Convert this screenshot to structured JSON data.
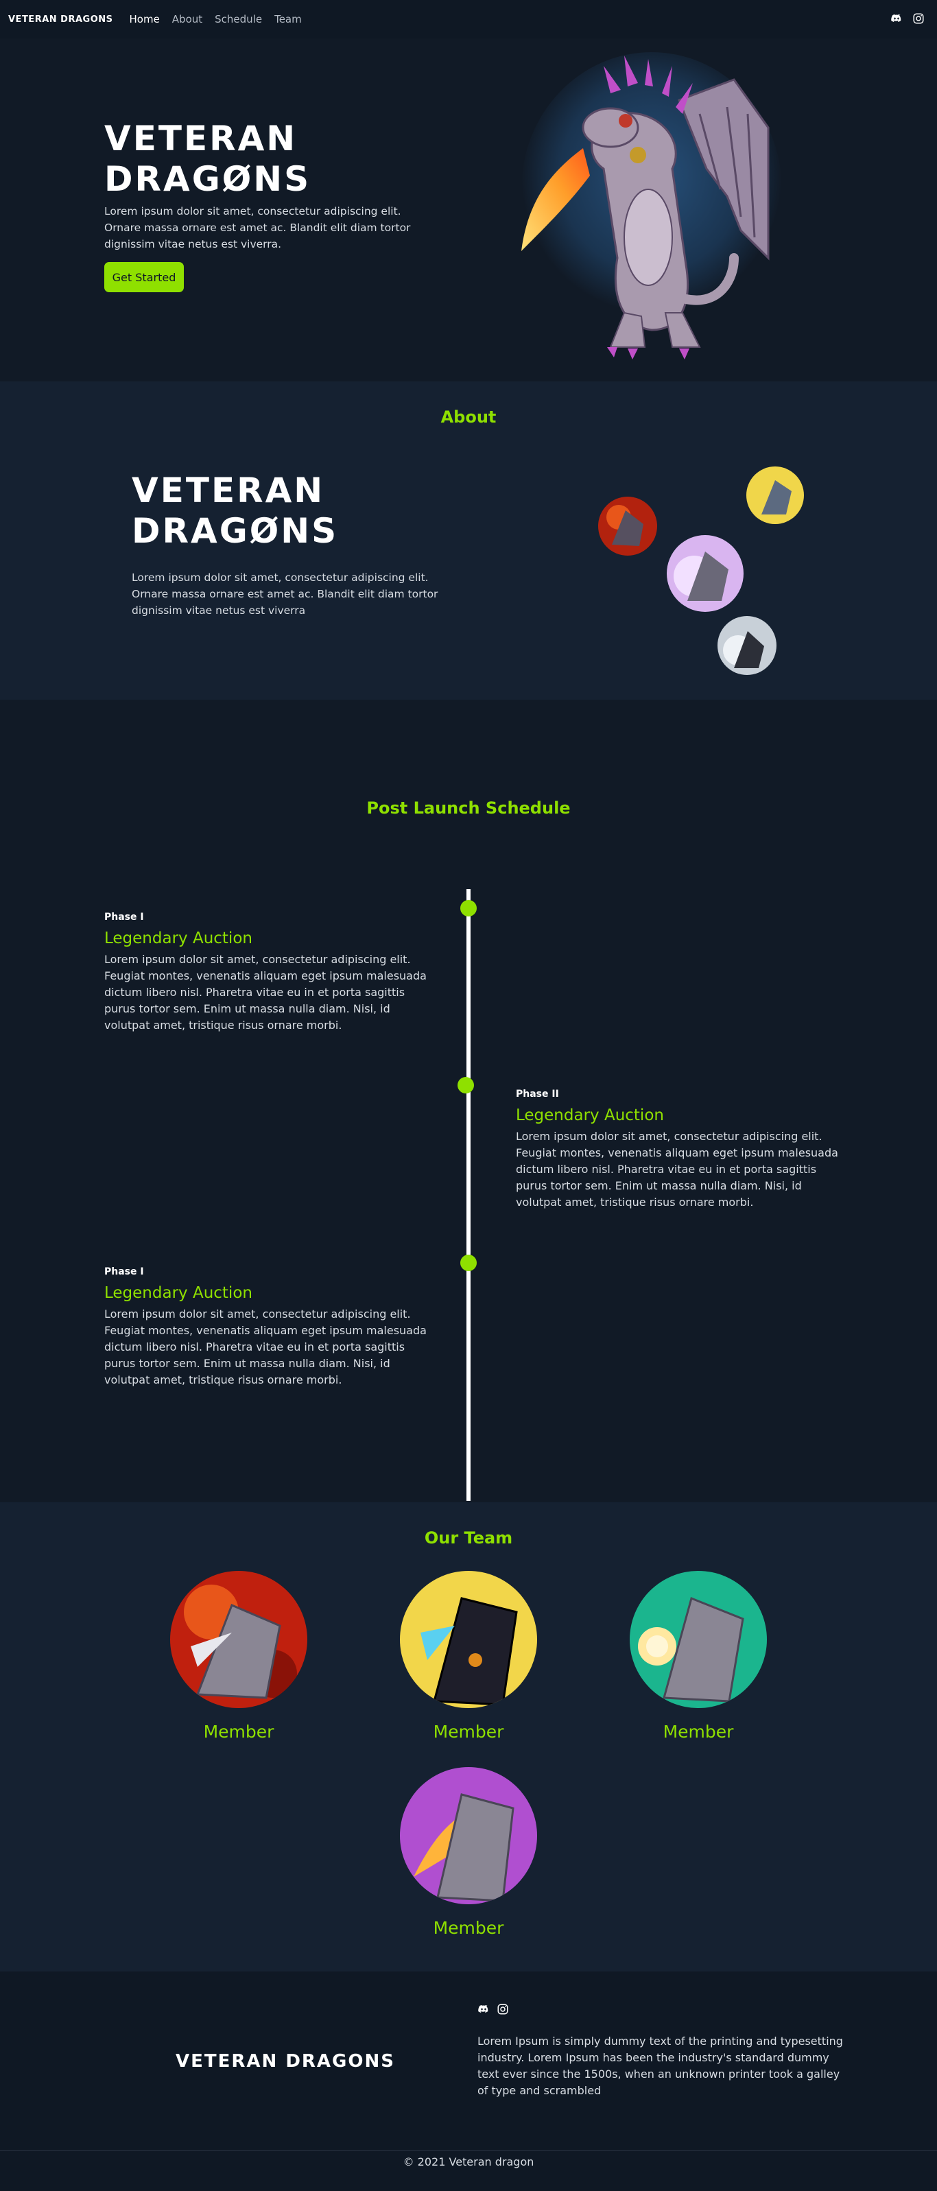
{
  "nav": {
    "brand": "VETERAN DRAGONS",
    "links": [
      "Home",
      "About",
      "Schedule",
      "Team"
    ],
    "icons": [
      "discord-icon",
      "instagram-icon"
    ]
  },
  "hero": {
    "title_line1": "VETERAN",
    "title_line2": "DRAGØNS",
    "text": "Lorem ipsum dolor sit amet, consectetur adipiscing elit. Ornare massa ornare est amet ac. Blandit elit diam tortor dignissim vitae netus est viverra.",
    "button": "Get Started"
  },
  "about": {
    "title": "About",
    "logo_line1": "VETERAN",
    "logo_line2": "DRAGØNS",
    "text": "Lorem ipsum dolor sit amet, consectetur adipiscing elit. Ornare massa ornare est amet ac. Blandit elit diam tortor dignissim vitae netus est viverra"
  },
  "schedule": {
    "title": "Post Launch Schedule",
    "phases": [
      {
        "label": "Phase I",
        "title": "Legendary Auction",
        "text": "Lorem ipsum dolor sit amet, consectetur adipiscing elit. Feugiat montes, venenatis aliquam eget ipsum malesuada dictum libero nisl. Pharetra vitae eu in et porta sagittis purus tortor sem. Enim ut massa nulla diam. Nisi, id volutpat amet, tristique risus ornare morbi."
      },
      {
        "label": "Phase II",
        "title": "Legendary Auction",
        "text": "Lorem ipsum dolor sit amet, consectetur adipiscing elit. Feugiat montes, venenatis aliquam eget ipsum malesuada dictum libero nisl. Pharetra vitae eu in et porta sagittis purus tortor sem. Enim ut massa nulla diam. Nisi, id volutpat amet, tristique risus ornare morbi."
      },
      {
        "label": "Phase I",
        "title": "Legendary Auction",
        "text": "Lorem ipsum dolor sit amet, consectetur adipiscing elit. Feugiat montes, venenatis aliquam eget ipsum malesuada dictum libero nisl. Pharetra vitae eu in et porta sagittis purus tortor sem. Enim ut massa nulla diam. Nisi, id volutpat amet, tristique risus ornare morbi."
      }
    ]
  },
  "team": {
    "title": "Our Team",
    "members": [
      {
        "label": "Member",
        "bg": "#c0200e"
      },
      {
        "label": "Member",
        "bg": "#f2d64a"
      },
      {
        "label": "Member",
        "bg": "#1bb58e"
      },
      {
        "label": "Member",
        "bg": "#b04fd0"
      }
    ]
  },
  "footer": {
    "logo": "VETERAN DRAGONS",
    "text": "Lorem Ipsum is simply dummy text of the printing and typesetting industry. Lorem Ipsum has been the industry's standard dummy text ever since the 1500s, when an unknown printer took a galley of type and scrambled",
    "copyright": "© 2021 Veteran dragon"
  },
  "colors": {
    "accent": "#8fe000",
    "background": "#111a26",
    "section_alt": "#152131"
  }
}
